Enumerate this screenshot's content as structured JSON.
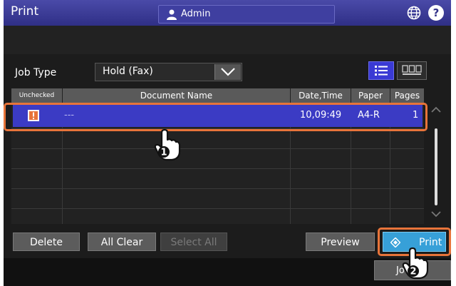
{
  "title": "Print",
  "user": {
    "name": "Admin",
    "icon": "user-icon"
  },
  "icons": {
    "globe": "globe-icon",
    "help": "?"
  },
  "job_type": {
    "label": "Job Type",
    "value": "Hold (Fax)"
  },
  "table": {
    "headers": [
      "Unchecked",
      "Document Name",
      "Date,Time",
      "Paper",
      "Pages"
    ],
    "rows": [
      {
        "status_icon": "warning-icon",
        "document": "---",
        "datetime": "10,09:49",
        "paper": "A4-R",
        "pages": "1",
        "selected": true
      }
    ]
  },
  "buttons": {
    "delete": "Delete",
    "all_clear": "All Clear",
    "select_all": "Select All",
    "preview": "Preview",
    "print": "Print",
    "job": "Jo"
  },
  "callouts": {
    "step1": "1",
    "step2": "2"
  },
  "colors": {
    "title_bar": "#3a3a96",
    "selection": "#3b3bc4",
    "print_button": "#37a0d8",
    "highlight_outline": "#e8743a"
  }
}
